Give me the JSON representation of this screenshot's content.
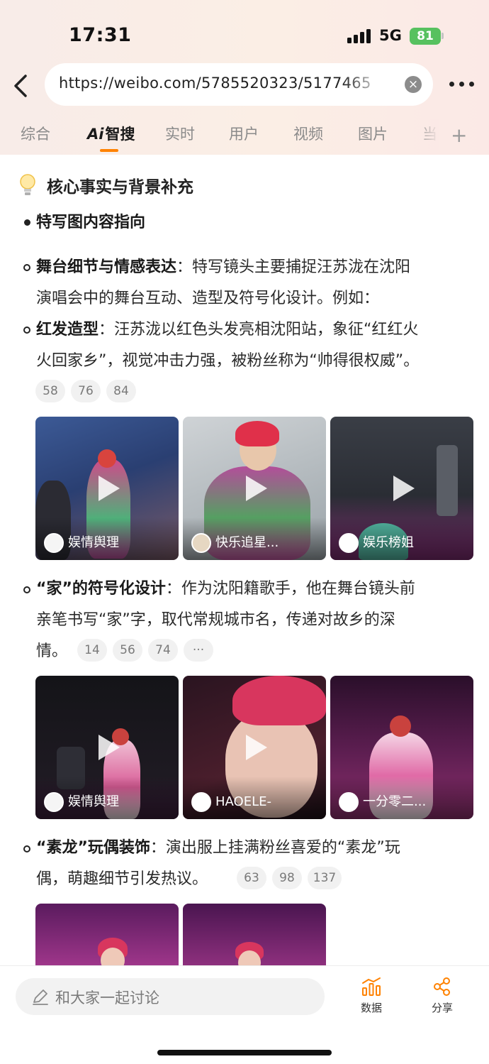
{
  "status_bar": {
    "time": "17:31",
    "network": "5G",
    "battery": "81"
  },
  "browser": {
    "url": "https://weibo.com/5785520323/5177465",
    "accent_color": "#ff8200"
  },
  "tabs": {
    "items": [
      {
        "label": "综合"
      },
      {
        "ai_mark": "Ai",
        "label": "智搜"
      },
      {
        "label": "实时"
      },
      {
        "label": "用户"
      },
      {
        "label": "视频"
      },
      {
        "label": "图片"
      },
      {
        "label": "当"
      }
    ],
    "active_index": 1,
    "add_icon": "plus-icon"
  },
  "section": {
    "icon": "lightbulb-icon",
    "title": "核心事实与背景补充"
  },
  "point1": {
    "title": "特写图内容指向"
  },
  "item1": {
    "bold": "舞台细节与情感表达",
    "text1": "：特写镜头主要捕捉汪苏泷在沈阳",
    "text2": "演唱会中的舞台互动、造型及符号化设计。例如："
  },
  "item2": {
    "bold": "红发造型",
    "text1": "：汪苏泷以红色头发亮相沈阳站，象征“红红火",
    "text2": "火回家乡”，视觉冲击力强，被粉丝称为“帅得很权威”。",
    "refs": [
      "58",
      "76",
      "84"
    ]
  },
  "videos_row1": [
    {
      "author": "娱情舆理"
    },
    {
      "author": "快乐追星..."
    },
    {
      "author": "娱乐榜姐"
    }
  ],
  "item3": {
    "bold": "“家”的符号化设计",
    "text1": "：作为沈阳籍歌手，他在舞台镜头前",
    "text2": "亲笔书写“家”字，取代常规城市名，传递对故乡的深",
    "text3": "情。",
    "refs": [
      "14",
      "56",
      "74"
    ],
    "more": "···"
  },
  "videos_row2": [
    {
      "author": "娱情舆理"
    },
    {
      "author": "HAOELE-"
    },
    {
      "author": "一分零二..."
    }
  ],
  "item4": {
    "bold": "“素龙”玩偶装饰",
    "text1": "：演出服上挂满粉丝喜爱的“素龙”玩",
    "text2": "偶，萌趣细节引发热议。",
    "refs": [
      "63",
      "98",
      "137"
    ]
  },
  "bottom_bar": {
    "discuss_placeholder": "和大家一起讨论",
    "data_label": "数据",
    "share_label": "分享"
  }
}
